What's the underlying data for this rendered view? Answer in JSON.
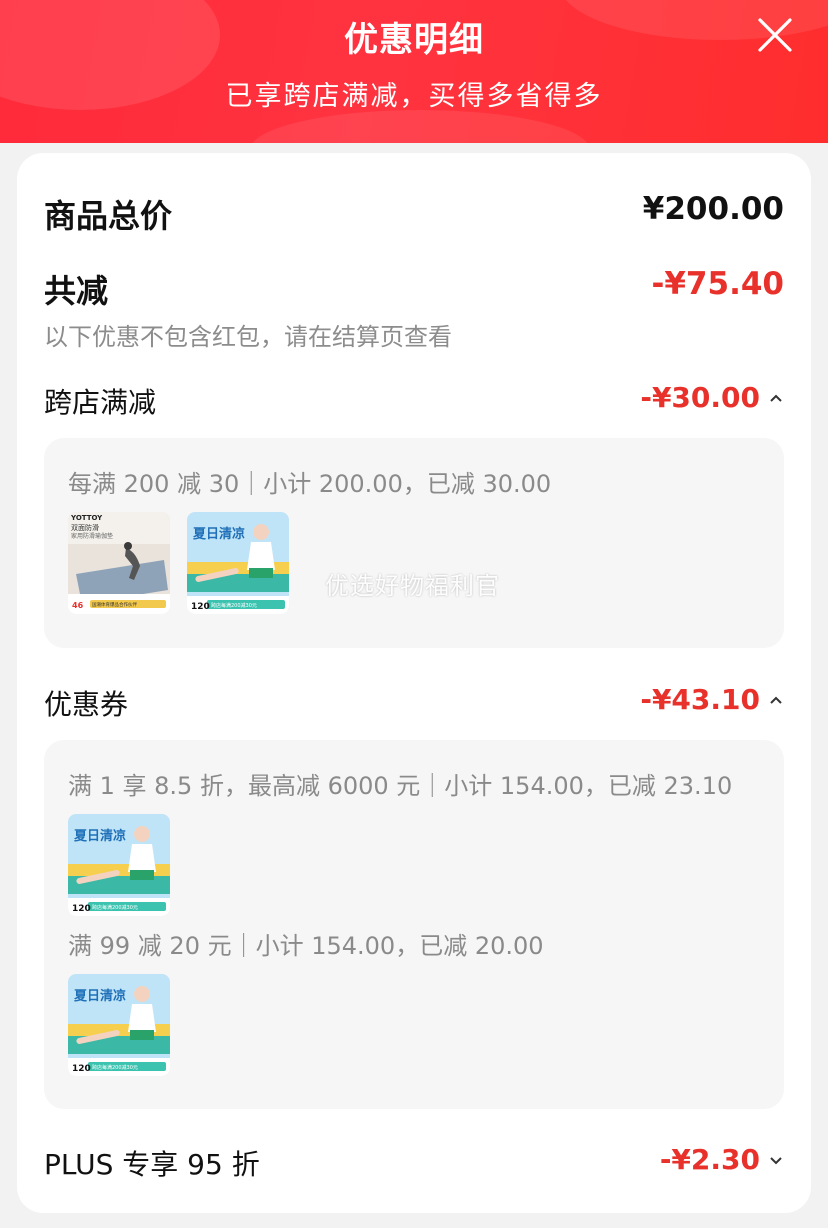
{
  "header": {
    "title": "优惠明细",
    "subtitle": "已享跨店满减，买得多省得多"
  },
  "summary": {
    "total_label": "商品总价",
    "total_value": "¥200.00",
    "reduce_label": "共减",
    "reduce_value": "-¥75.40",
    "note": "以下优惠不包含红包，请在结算页查看"
  },
  "sections": [
    {
      "title": "跨店满减",
      "amount": "-¥30.00",
      "expanded": true,
      "groups": [
        {
          "rule": "每满 200 减 30｜小计 200.00，已减 30.00",
          "items": [
            {
              "brand": "YOTTOY",
              "name": "双面防滑",
              "sub": "家用防滑瑜伽垫",
              "price": "46",
              "tag": "国潮体育爆品合作伙伴"
            },
            {
              "brand": "跨店每满200减30元",
              "name": "夏日清凉",
              "price": "120",
              "tag": "跨店每满200减30元"
            }
          ]
        }
      ],
      "watermark": "优选好物福利官"
    },
    {
      "title": "优惠券",
      "amount": "-¥43.10",
      "expanded": true,
      "groups": [
        {
          "rule": "满 1 享 8.5 折，最高减 6000 元｜小计 154.00，已减 23.10",
          "items": [
            {
              "name": "夏日清凉",
              "price": "120",
              "tag": "跨店每满200减30元"
            }
          ]
        },
        {
          "rule": "满 99 减 20 元｜小计 154.00，已减 20.00",
          "items": [
            {
              "name": "夏日清凉",
              "price": "120",
              "tag": "跨店每满200减30元"
            }
          ]
        }
      ]
    },
    {
      "title": "PLUS 专享 95 折",
      "amount": "-¥2.30",
      "expanded": false
    }
  ],
  "colors": {
    "header_red": "#ff2a3a",
    "discount_red": "#e8312b",
    "panel_bg": "#f6f6f6"
  },
  "icons": [
    "close-icon",
    "chevron-up-icon",
    "chevron-down-icon"
  ]
}
